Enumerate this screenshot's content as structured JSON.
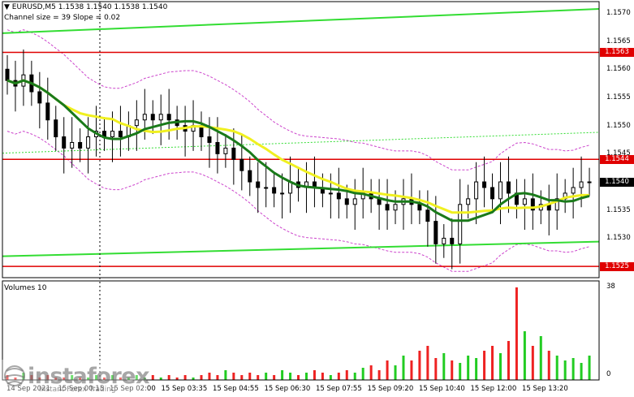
{
  "header": {
    "title": "EURUSD,M5",
    "ohlc": "1.1538 1.1540 1.1538 1.1540",
    "channel_info": "Channel size = 39 Slope = 0.02"
  },
  "price_axis": [
    "1.1570",
    "1.1565",
    "1.1560",
    "1.1555",
    "1.1550",
    "1.1545",
    "1.1540",
    "1.1535",
    "1.1530",
    "1.1525"
  ],
  "price_tags": [
    {
      "value": "1.1563",
      "style": "level"
    },
    {
      "value": "1.1544",
      "style": "level"
    },
    {
      "value": "1.1540",
      "style": "current"
    },
    {
      "value": "1.1525",
      "style": "level"
    }
  ],
  "time_axis": [
    "14 Sep 2021",
    "15 Sep 00:15",
    "15 Sep 02:00",
    "15 Sep 03:35",
    "15 Sep 04:55",
    "15 Sep 06:30",
    "15 Sep 07:55",
    "15 Sep 09:20",
    "15 Sep 10:40",
    "15 Sep 12:00",
    "15 Sep 13:20"
  ],
  "volumes": {
    "label": "Volumes 10",
    "axis_max": "38",
    "axis_min": "0"
  },
  "watermark": {
    "brand": "instaforex",
    "tagline": "Instant Forex Trading"
  },
  "colors": {
    "level_line": "#e00000",
    "channel": "#33dd33",
    "ma_fast": "#1a7a1a",
    "ma_slow": "#f0f020",
    "envelope": "#cc44cc",
    "volume_up": "#22cc22",
    "volume_down": "#ee2222"
  },
  "chart_data": {
    "type": "candlestick",
    "symbol": "EURUSD",
    "timeframe": "M5",
    "ylim": [
      1.1523,
      1.1572
    ],
    "horizontal_levels": [
      1.1563,
      1.1544,
      1.1525
    ],
    "closes": [
      1.1558,
      1.1557,
      1.1559,
      1.1556,
      1.1554,
      1.1551,
      1.1548,
      1.1546,
      1.1547,
      1.1546,
      1.1548,
      1.1549,
      1.1548,
      1.1549,
      1.1548,
      1.155,
      1.1551,
      1.1552,
      1.1551,
      1.1552,
      1.1551,
      1.155,
      1.1549,
      1.155,
      1.1548,
      1.1547,
      1.1545,
      1.1546,
      1.1544,
      1.1542,
      1.154,
      1.1539,
      1.1539,
      1.1538,
      1.1538,
      1.154,
      1.1539,
      1.154,
      1.1539,
      1.1538,
      1.1538,
      1.1537,
      1.1536,
      1.1537,
      1.1538,
      1.1537,
      1.1536,
      1.1535,
      1.1536,
      1.1537,
      1.1536,
      1.1535,
      1.1533,
      1.1529,
      1.153,
      1.1529,
      1.1536,
      1.1537,
      1.154,
      1.1539,
      1.1537,
      1.154,
      1.1538,
      1.1536,
      1.1537,
      1.1535,
      1.1536,
      1.1535,
      1.1537,
      1.1538,
      1.1539,
      1.154,
      1.154
    ],
    "volumes": [
      2,
      1,
      3,
      2,
      1,
      2,
      1,
      1,
      2,
      1,
      1,
      2,
      1,
      2,
      1,
      1,
      2,
      1,
      2,
      1,
      2,
      1,
      2,
      1,
      2,
      3,
      2,
      4,
      3,
      2,
      3,
      2,
      3,
      2,
      4,
      3,
      2,
      3,
      4,
      3,
      2,
      3,
      4,
      3,
      5,
      6,
      4,
      8,
      6,
      10,
      8,
      12,
      14,
      9,
      11,
      8,
      7,
      10,
      9,
      12,
      14,
      11,
      16,
      38,
      20,
      14,
      18,
      12,
      10,
      8,
      9,
      7,
      10
    ]
  }
}
